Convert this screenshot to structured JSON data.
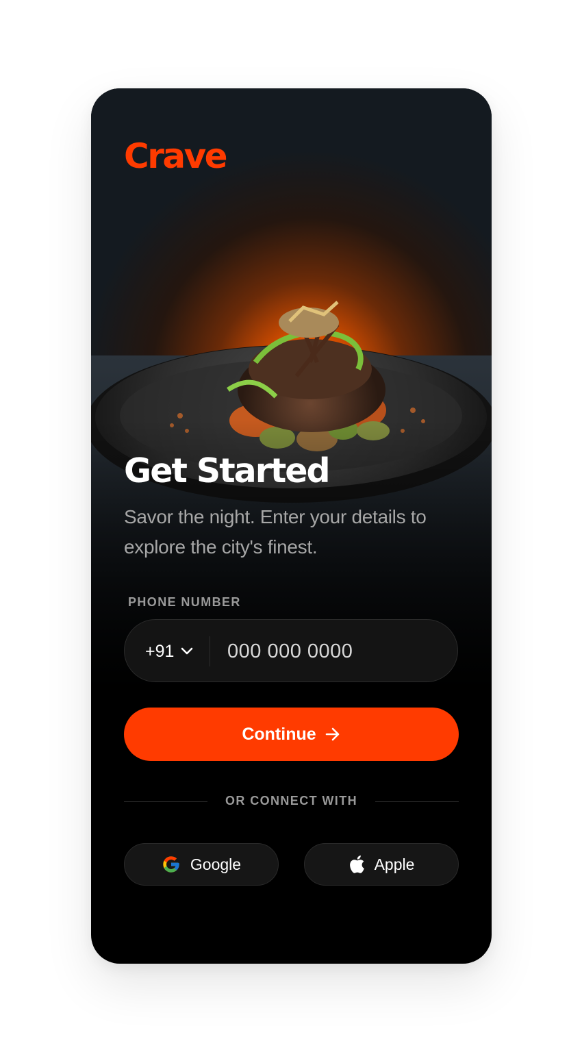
{
  "app": {
    "logo": "Crave"
  },
  "hero": {
    "image_icon": "plated-steak-dish-image"
  },
  "heading": {
    "title": "Get Started",
    "subtitle": "Savor the night. Enter your details to explore the city's finest."
  },
  "phone": {
    "label": "PHONE NUMBER",
    "country_code": "+91",
    "placeholder": "000 000 0000",
    "value": ""
  },
  "continue_button": {
    "label": "Continue",
    "icon": "arrow-right-icon"
  },
  "divider": {
    "label": "OR CONNECT WITH"
  },
  "social": {
    "google": {
      "label": "Google",
      "icon": "google-icon"
    },
    "apple": {
      "label": "Apple",
      "icon": "apple-icon"
    }
  },
  "colors": {
    "accent": "#FF3B00",
    "background": "#000000",
    "field_bg": "#141414",
    "muted_text": "#9A9A9A"
  }
}
